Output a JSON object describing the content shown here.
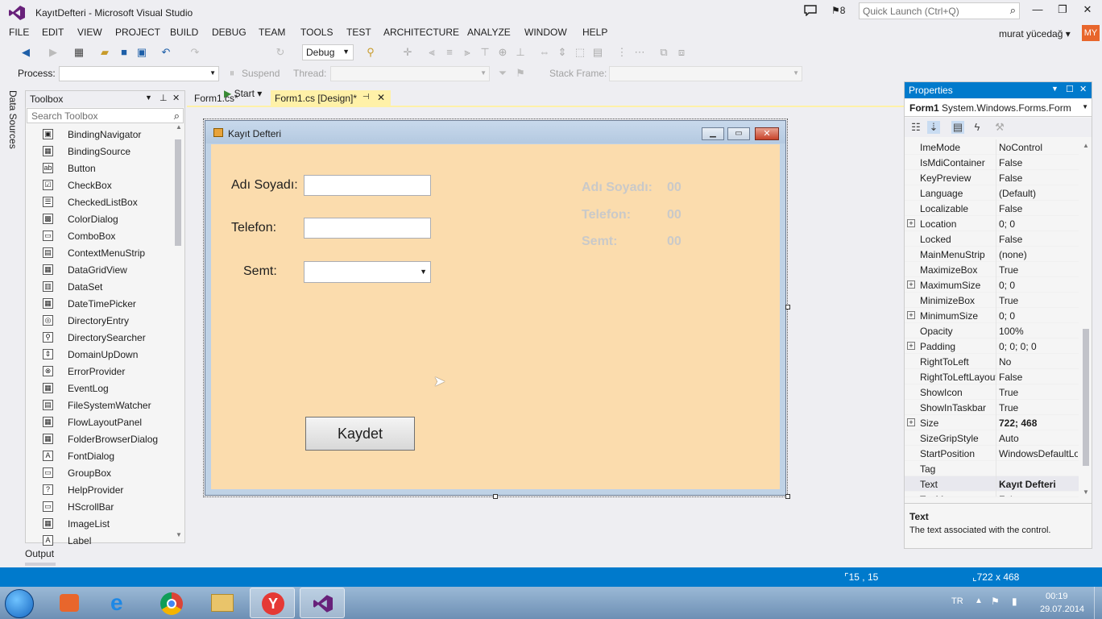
{
  "window": {
    "title": "KayıtDefteri - Microsoft Visual Studio",
    "notification_count": "8",
    "quick_launch_placeholder": "Quick Launch (Ctrl+Q)"
  },
  "menu": [
    "FILE",
    "EDIT",
    "VIEW",
    "PROJECT",
    "BUILD",
    "DEBUG",
    "TEAM",
    "TOOLS",
    "TEST",
    "ARCHITECTURE",
    "ANALYZE",
    "WINDOW",
    "HELP"
  ],
  "user": {
    "name": "murat yücedağ",
    "initials": "MY"
  },
  "toolbar": {
    "start_label": "Start",
    "config_value": "Debug",
    "process_label": "Process:",
    "suspend_label": "Suspend",
    "thread_label": "Thread:",
    "stack_frame_label": "Stack Frame:"
  },
  "side_tab": "Data Sources",
  "toolbox": {
    "title": "Toolbox",
    "search_placeholder": "Search Toolbox",
    "items": [
      "BindingNavigator",
      "BindingSource",
      "Button",
      "CheckBox",
      "CheckedListBox",
      "ColorDialog",
      "ComboBox",
      "ContextMenuStrip",
      "DataGridView",
      "DataSet",
      "DateTimePicker",
      "DirectoryEntry",
      "DirectorySearcher",
      "DomainUpDown",
      "ErrorProvider",
      "EventLog",
      "FileSystemWatcher",
      "FlowLayoutPanel",
      "FolderBrowserDialog",
      "FontDialog",
      "GroupBox",
      "HelpProvider",
      "HScrollBar",
      "ImageList",
      "Label"
    ]
  },
  "tabs": [
    {
      "label": "Form1.cs*"
    },
    {
      "label": "Form1.cs [Design]*"
    }
  ],
  "form": {
    "title": "Kayıt Defteri",
    "labels": {
      "name": "Adı Soyadı:",
      "phone": "Telefon:",
      "district": "Semt:"
    },
    "display_labels": {
      "name": "Adı Soyadı:",
      "phone": "Telefon:",
      "district": "Semt:"
    },
    "display_values": {
      "name": "00",
      "phone": "00",
      "district": "00"
    },
    "save_button": "Kaydet"
  },
  "properties": {
    "title": "Properties",
    "object_name": "Form1",
    "object_type": "System.Windows.Forms.Form",
    "rows": [
      {
        "name": "ImeMode",
        "value": "NoControl",
        "expand": false,
        "bold": false
      },
      {
        "name": "IsMdiContainer",
        "value": "False",
        "expand": false,
        "bold": false
      },
      {
        "name": "KeyPreview",
        "value": "False",
        "expand": false,
        "bold": false
      },
      {
        "name": "Language",
        "value": "(Default)",
        "expand": false,
        "bold": false
      },
      {
        "name": "Localizable",
        "value": "False",
        "expand": false,
        "bold": false
      },
      {
        "name": "Location",
        "value": "0; 0",
        "expand": true,
        "bold": false
      },
      {
        "name": "Locked",
        "value": "False",
        "expand": false,
        "bold": false
      },
      {
        "name": "MainMenuStrip",
        "value": "(none)",
        "expand": false,
        "bold": false
      },
      {
        "name": "MaximizeBox",
        "value": "True",
        "expand": false,
        "bold": false
      },
      {
        "name": "MaximumSize",
        "value": "0; 0",
        "expand": true,
        "bold": false
      },
      {
        "name": "MinimizeBox",
        "value": "True",
        "expand": false,
        "bold": false
      },
      {
        "name": "MinimumSize",
        "value": "0; 0",
        "expand": true,
        "bold": false
      },
      {
        "name": "Opacity",
        "value": "100%",
        "expand": false,
        "bold": false
      },
      {
        "name": "Padding",
        "value": "0; 0; 0; 0",
        "expand": true,
        "bold": false
      },
      {
        "name": "RightToLeft",
        "value": "No",
        "expand": false,
        "bold": false
      },
      {
        "name": "RightToLeftLayout",
        "value": "False",
        "expand": false,
        "bold": false
      },
      {
        "name": "ShowIcon",
        "value": "True",
        "expand": false,
        "bold": false
      },
      {
        "name": "ShowInTaskbar",
        "value": "True",
        "expand": false,
        "bold": false
      },
      {
        "name": "Size",
        "value": "722; 468",
        "expand": true,
        "bold": true
      },
      {
        "name": "SizeGripStyle",
        "value": "Auto",
        "expand": false,
        "bold": false
      },
      {
        "name": "StartPosition",
        "value": "WindowsDefaultLocation",
        "expand": false,
        "bold": false
      },
      {
        "name": "Tag",
        "value": "",
        "expand": false,
        "bold": false
      },
      {
        "name": "Text",
        "value": "Kayıt Defteri",
        "expand": false,
        "bold": true,
        "selected": true
      },
      {
        "name": "TopMost",
        "value": "False",
        "expand": false,
        "bold": false
      }
    ],
    "description_title": "Text",
    "description_text": "The text associated with the control."
  },
  "output_tab": "Output",
  "status": {
    "position": "15 , 15",
    "size": "722 x 468"
  },
  "tray": {
    "language": "TR",
    "time": "00:19",
    "date": "29.07.2014"
  },
  "colors": {
    "accent": "#007acc",
    "form_bg": "#fbdcad",
    "active_tab": "#fff1a8"
  }
}
